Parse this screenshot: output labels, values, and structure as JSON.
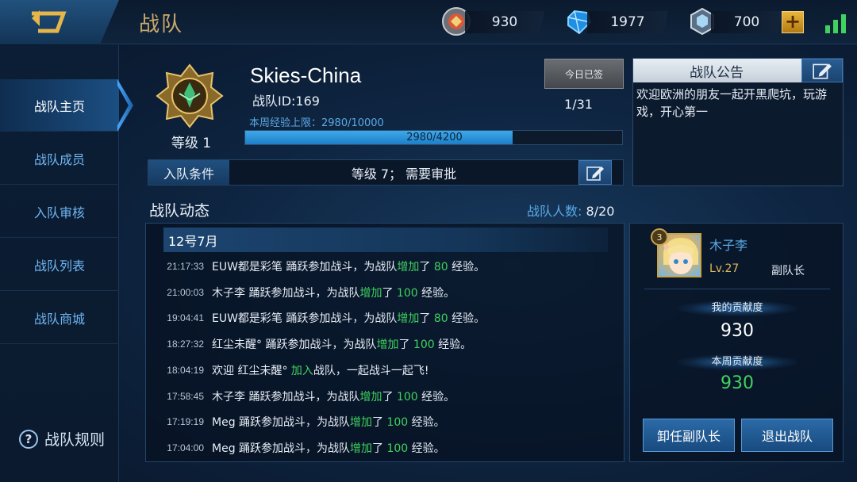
{
  "header": {
    "title": "战队",
    "currencies": [
      {
        "icon": "gold-coin-icon",
        "value": "930"
      },
      {
        "icon": "diamond-icon",
        "value": "1977"
      },
      {
        "icon": "crystal-icon",
        "value": "700"
      }
    ],
    "add_label": "+"
  },
  "sidebar": {
    "items": [
      {
        "label": "战队主页",
        "active": true
      },
      {
        "label": "战队成员",
        "active": false
      },
      {
        "label": "入队审核",
        "active": false
      },
      {
        "label": "战队列表",
        "active": false
      },
      {
        "label": "战队商城",
        "active": false
      }
    ],
    "rules_icon": "?",
    "rules_label": "战队规则"
  },
  "team": {
    "name": "Skies-China",
    "id_text": "战队ID:169",
    "level_text": "等级 1",
    "weekly_exp_text": "本周经验上限：2980/10000",
    "exp_text": "2980/4200",
    "exp_fraction": 0.7095,
    "signin_label": "今日已签",
    "signin_count": "1/31",
    "join_condition_label": "入队条件",
    "join_condition_value": "等级 7； 需要审批"
  },
  "notice": {
    "title": "战队公告",
    "body": "欢迎欧洲的朋友一起开黑爬坑，玩游戏，开心第一"
  },
  "activity": {
    "title": "战队动态",
    "member_count_label": "战队人数:",
    "member_count_value": "8/20",
    "date": "12号7月",
    "entries": [
      {
        "time": "21:17:33",
        "pre": "EUW都是彩笔 踊跃参加战斗，为战队",
        "hl": "增加",
        "mid": "了 ",
        "num": "80",
        "post": " 经验。"
      },
      {
        "time": "21:00:03",
        "pre": "木子李 踊跃参加战斗，为战队",
        "hl": "增加",
        "mid": "了 ",
        "num": "100",
        "post": " 经验。"
      },
      {
        "time": "19:04:41",
        "pre": "EUW都是彩笔 踊跃参加战斗，为战队",
        "hl": "增加",
        "mid": "了 ",
        "num": "80",
        "post": " 经验。"
      },
      {
        "time": "18:27:32",
        "pre": "红尘未醒° 踊跃参加战斗，为战队",
        "hl": "增加",
        "mid": "了 ",
        "num": "100",
        "post": " 经验。"
      },
      {
        "time": "18:04:19",
        "pre": "欢迎 红尘未醒° ",
        "hl": "加入",
        "mid": "",
        "num": "",
        "post": "战队，一起战斗一起飞!"
      },
      {
        "time": "17:58:45",
        "pre": "木子李 踊跃参加战斗，为战队",
        "hl": "增加",
        "mid": "了 ",
        "num": "100",
        "post": " 经验。"
      },
      {
        "time": "17:19:19",
        "pre": "Meg 踊跃参加战斗，为战队",
        "hl": "增加",
        "mid": "了 ",
        "num": "100",
        "post": " 经验。"
      },
      {
        "time": "17:04:00",
        "pre": "Meg 踊跃参加战斗，为战队",
        "hl": "增加",
        "mid": "了 ",
        "num": "100",
        "post": " 经验。"
      }
    ]
  },
  "member": {
    "name": "木子李",
    "level": "Lv.27",
    "role": "副队长",
    "badge": "3",
    "my_contribution_label": "我的贡献度",
    "my_contribution_value": "930",
    "weekly_contribution_label": "本周贡献度",
    "weekly_contribution_value": "930",
    "resign_label": "卸任副队长",
    "quit_label": "退出战队"
  },
  "colors": {
    "accent_blue": "#5aa9e6",
    "highlight_green": "#3fd25e",
    "gold": "#c9a96a"
  }
}
